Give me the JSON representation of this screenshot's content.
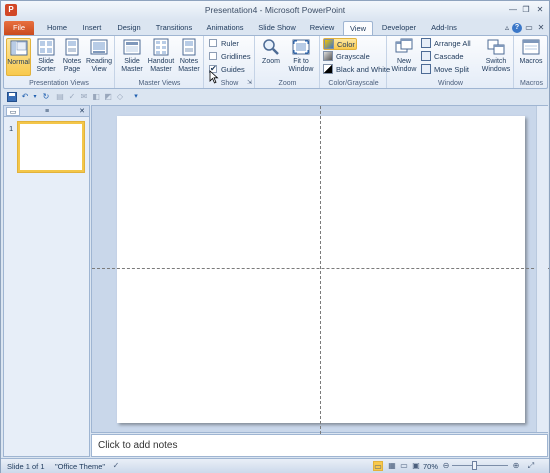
{
  "window": {
    "title": "Presentation4 - Microsoft PowerPoint",
    "app_icon": "P",
    "controls": [
      "—",
      "❐",
      "✕"
    ]
  },
  "tabs": {
    "file": "File",
    "items": [
      "Home",
      "Insert",
      "Design",
      "Transitions",
      "Animations",
      "Slide Show",
      "Review",
      "View",
      "Developer",
      "Add-Ins"
    ],
    "active": "View",
    "ribbon_controls": [
      "▵",
      "?",
      "▭",
      "✕"
    ]
  },
  "ribbon": {
    "presentation_views": {
      "label": "Presentation Views",
      "buttons": [
        "Normal",
        "Slide Sorter",
        "Notes Page",
        "Reading View"
      ],
      "selected": "Normal"
    },
    "master_views": {
      "label": "Master Views",
      "buttons": [
        "Slide Master",
        "Handout Master",
        "Notes Master"
      ]
    },
    "show": {
      "label": "Show",
      "items": [
        {
          "label": "Ruler",
          "checked": false
        },
        {
          "label": "Gridlines",
          "checked": false
        },
        {
          "label": "Guides",
          "checked": true
        }
      ]
    },
    "zoom": {
      "label": "Zoom",
      "buttons": [
        "Zoom",
        "Fit to Window"
      ]
    },
    "color": {
      "label": "Color/Grayscale",
      "items": [
        "Color",
        "Grayscale",
        "Black and White"
      ],
      "selected": "Color"
    },
    "window": {
      "label": "Window",
      "new_window": "New Window",
      "items": [
        "Arrange All",
        "Cascade",
        "Move Split"
      ],
      "switch": "Switch Windows"
    },
    "macros": {
      "label": "Macros",
      "button": "Macros"
    }
  },
  "qat": {
    "icons": [
      "save-icon",
      "undo-icon",
      "redo-icon",
      "customize-icon"
    ]
  },
  "thumbnails": {
    "slide_number": "1"
  },
  "notes": {
    "placeholder": "Click to add notes"
  },
  "status": {
    "slide": "Slide 1 of 1",
    "theme": "\"Office Theme\"",
    "zoom": "70%"
  },
  "colors": {
    "accent": "#d24726",
    "selected": "#f8c94d",
    "frame": "#dbe5f1"
  }
}
